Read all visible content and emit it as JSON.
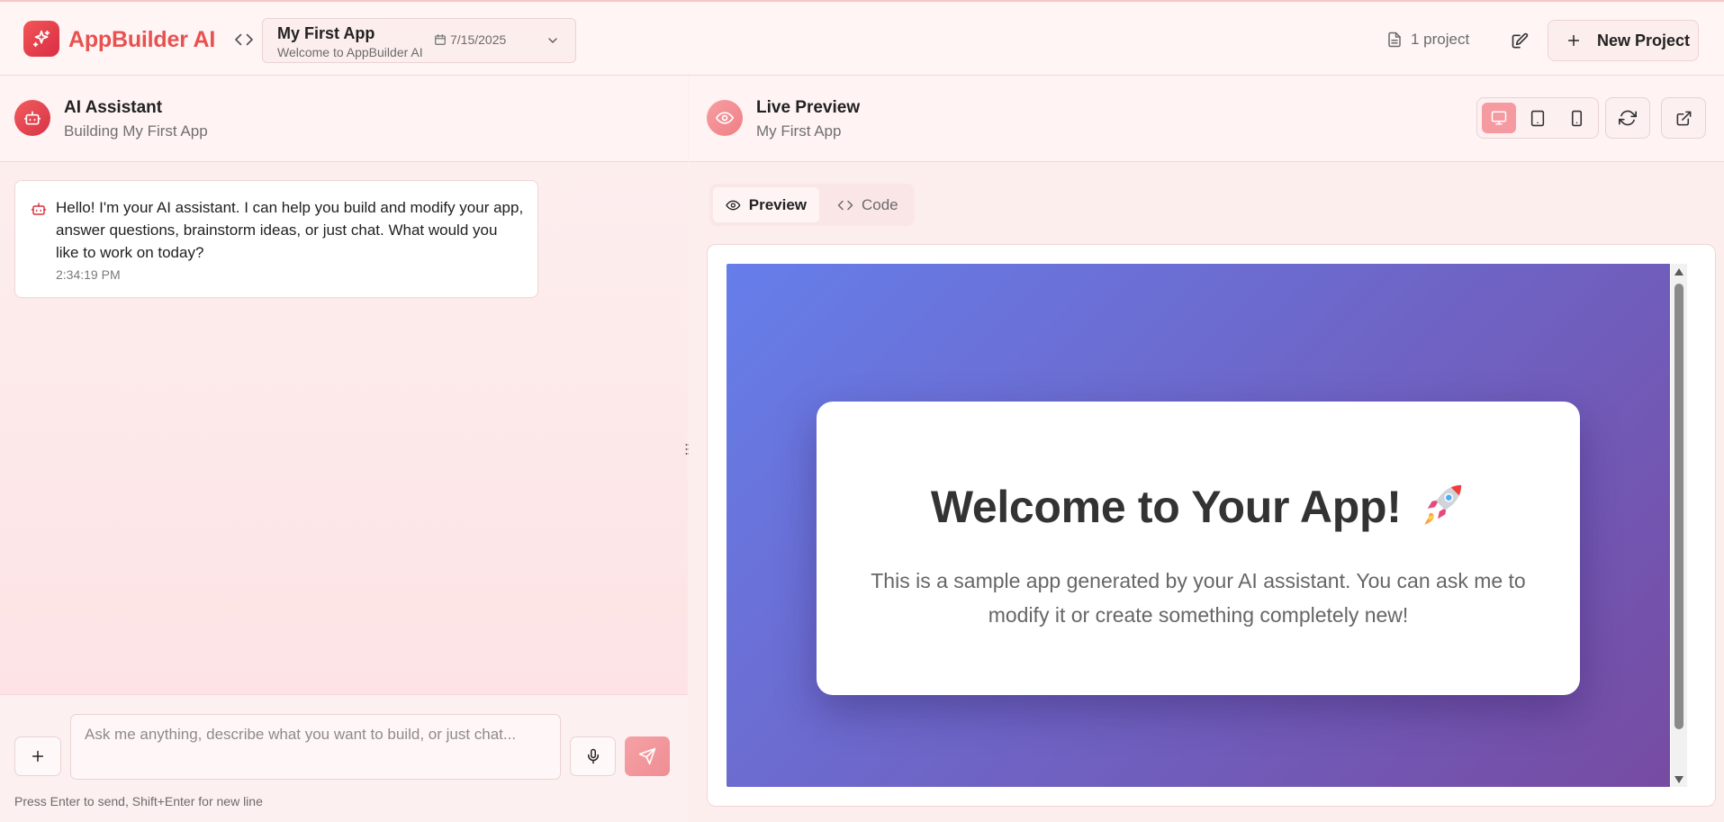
{
  "header": {
    "brand": "AppBuilder AI",
    "project": {
      "name": "My First App",
      "subtitle": "Welcome to AppBuilder AI",
      "date": "7/15/2025"
    },
    "project_count": "1 project",
    "new_project_label": "New Project"
  },
  "assistant": {
    "title": "AI Assistant",
    "subtitle": "Building My First App",
    "messages": [
      {
        "text": "Hello! I'm your AI assistant. I can help you build and modify your app, answer questions, brainstorm ideas, or just chat. What would you like to work on today?",
        "time": "2:34:19 PM"
      }
    ],
    "input": {
      "value": "",
      "placeholder": "Ask me anything, describe what you want to build, or just chat..."
    },
    "hint": "Press Enter to send, Shift+Enter for new line"
  },
  "preview": {
    "title": "Live Preview",
    "subtitle": "My First App",
    "devices": [
      "desktop",
      "tablet",
      "mobile"
    ],
    "active_device": "desktop",
    "tabs": [
      {
        "label": "Preview",
        "icon": "eye-icon",
        "active": true
      },
      {
        "label": "Code",
        "icon": "code-icon",
        "active": false
      }
    ],
    "app": {
      "heading": "Welcome to Your App!",
      "emoji": "rocket",
      "text": "This is a sample app generated by your AI assistant. You can ask me to modify it or create something completely new!"
    }
  },
  "colors": {
    "brand": "#e8514f",
    "accent_light": "#f59aa0",
    "gradient_start": "#667eea",
    "gradient_end": "#764ba2"
  }
}
